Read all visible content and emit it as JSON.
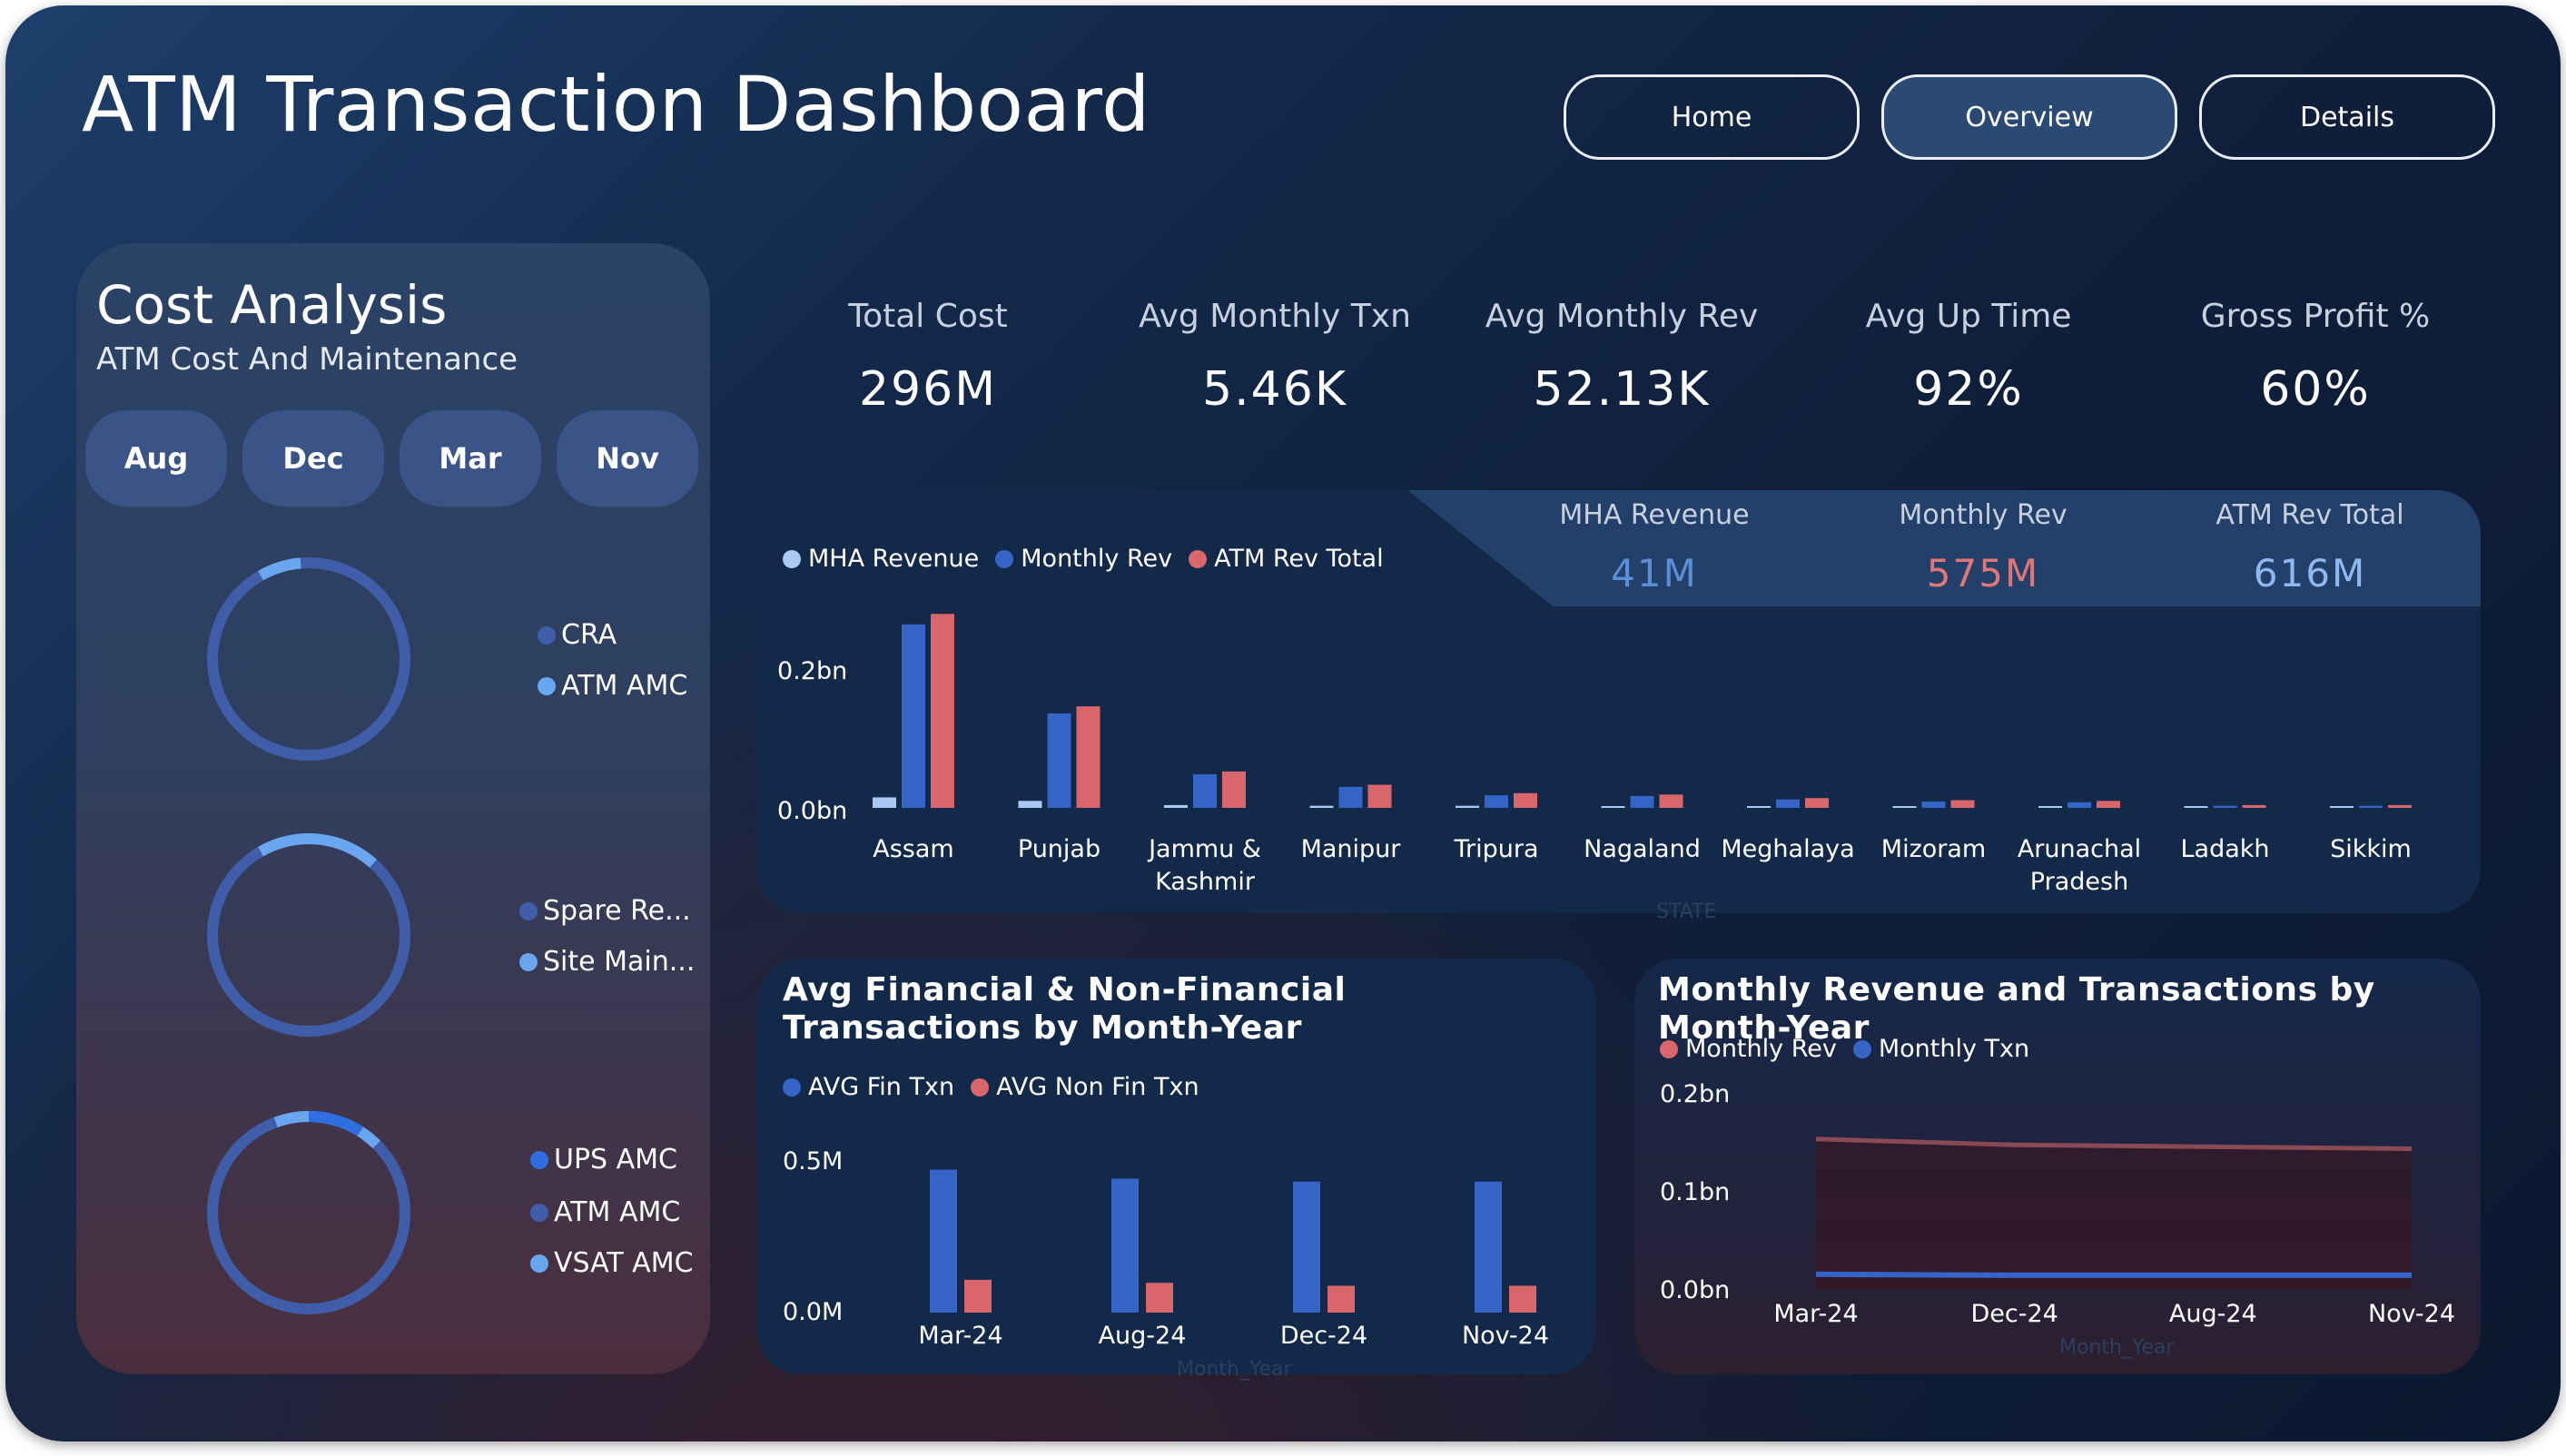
{
  "app": {
    "title": "ATM Transaction Dashboard"
  },
  "nav": {
    "home": "Home",
    "overview": "Overview",
    "details": "Details",
    "active": "Overview"
  },
  "cost_panel": {
    "title": "Cost Analysis",
    "subtitle": "ATM Cost And Maintenance",
    "months": [
      "Aug",
      "Dec",
      "Mar",
      "Nov"
    ],
    "donuts": [
      {
        "legend": [
          {
            "label": "CRA",
            "color": "#3f5da8"
          },
          {
            "label": "ATM AMC",
            "color": "#6aa6f0"
          }
        ],
        "highlight_fraction": 0.07
      },
      {
        "legend": [
          {
            "label": "Spare Re...",
            "color": "#3f5da8"
          },
          {
            "label": "Site Main...",
            "color": "#6aa6f0"
          }
        ],
        "highlight_fraction": 0.2
      },
      {
        "legend": [
          {
            "label": "UPS AMC",
            "color": "#2f6ee0"
          },
          {
            "label": "ATM AMC",
            "color": "#3f5da8"
          },
          {
            "label": "VSAT AMC",
            "color": "#6aa6f0"
          }
        ],
        "highlight_fraction": 0.18
      }
    ]
  },
  "kpis": [
    {
      "label": "Total Cost",
      "value": "296M"
    },
    {
      "label": "Avg Monthly Txn",
      "value": "5.46K"
    },
    {
      "label": "Avg Monthly Rev",
      "value": "52.13K"
    },
    {
      "label": "Avg Up Time",
      "value": "92%"
    },
    {
      "label": "Gross Profit %",
      "value": "60%"
    }
  ],
  "revenue_kpis": [
    {
      "label": "MHA Revenue",
      "value": "41M",
      "color": "#5b8fd6"
    },
    {
      "label": "Monthly Rev",
      "value": "575M",
      "color": "#e07676"
    },
    {
      "label": "ATM Rev Total",
      "value": "616M",
      "color": "#8fb7f0"
    }
  ],
  "colors": {
    "light_blue": "#a9c8f3",
    "blue": "#3565c6",
    "red": "#d9666b"
  },
  "chart_data": [
    {
      "type": "bar",
      "legend": [
        "MHA Revenue",
        "Monthly Rev",
        "ATM Rev Total"
      ],
      "categories": [
        "Assam",
        "Punjab",
        "Jammu & Kashmir",
        "Manipur",
        "Tripura",
        "Nagaland",
        "Meghalaya",
        "Mizoram",
        "Arunachal Pradesh",
        "Ladakh",
        "Sikkim"
      ],
      "series": [
        {
          "name": "MHA Revenue",
          "values": [
            0.015,
            0.01,
            0.004,
            0.003,
            0.003,
            0.002,
            0.002,
            0.002,
            0.002,
            0.001,
            0.001
          ]
        },
        {
          "name": "Monthly Rev",
          "values": [
            0.262,
            0.135,
            0.048,
            0.03,
            0.018,
            0.017,
            0.012,
            0.009,
            0.008,
            0.003,
            0.003
          ]
        },
        {
          "name": "ATM Rev Total",
          "values": [
            0.277,
            0.145,
            0.052,
            0.033,
            0.021,
            0.019,
            0.014,
            0.011,
            0.01,
            0.004,
            0.004
          ]
        }
      ],
      "yticks": [
        "0.0bn",
        "0.2bn"
      ],
      "ylim": [
        0,
        0.28
      ],
      "xlabel": "STATE"
    },
    {
      "type": "bar",
      "title": "Avg Financial & Non-Financial Transactions by Month-Year",
      "legend": [
        "AVG Fin Txn",
        "AVG Non Fin Txn"
      ],
      "categories": [
        "Mar-24",
        "Aug-24",
        "Dec-24",
        "Nov-24"
      ],
      "series": [
        {
          "name": "AVG Fin Txn",
          "values": [
            0.48,
            0.45,
            0.44,
            0.44
          ]
        },
        {
          "name": "AVG Non Fin Txn",
          "values": [
            0.11,
            0.1,
            0.09,
            0.09
          ]
        }
      ],
      "yticks": [
        "0.0M",
        "0.5M"
      ],
      "ylim": [
        0,
        0.55
      ],
      "xlabel": "Month_Year"
    },
    {
      "type": "area",
      "title": "Monthly Revenue and Transactions by Month-Year",
      "legend": [
        "Monthly Rev",
        "Monthly Txn"
      ],
      "categories": [
        "Mar-24",
        "Dec-24",
        "Aug-24",
        "Nov-24"
      ],
      "series": [
        {
          "name": "Monthly Rev",
          "values": [
            0.153,
            0.147,
            0.145,
            0.143
          ]
        },
        {
          "name": "Monthly Txn",
          "values": [
            0.015,
            0.014,
            0.014,
            0.014
          ]
        }
      ],
      "yticks": [
        "0.0bn",
        "0.1bn",
        "0.2bn"
      ],
      "ylim": [
        0,
        0.2
      ],
      "xlabel": "Month_Year"
    }
  ]
}
